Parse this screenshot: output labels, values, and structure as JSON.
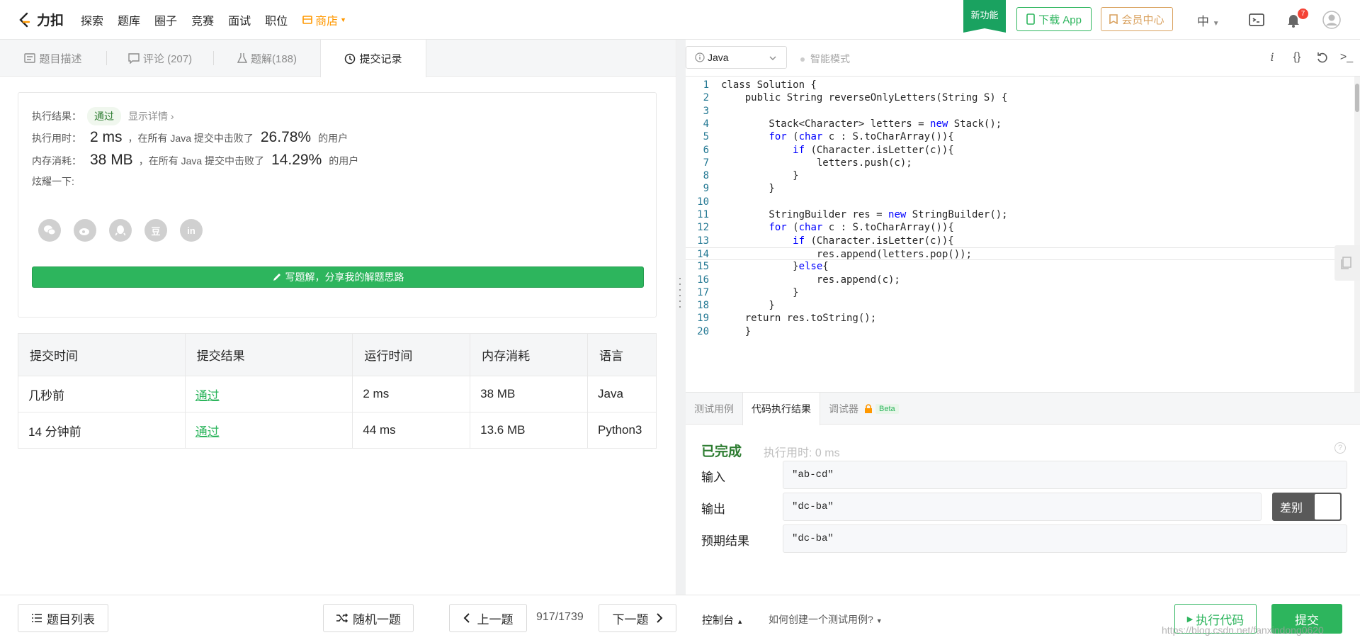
{
  "topbar": {
    "logo": "力扣",
    "nav": [
      "探索",
      "题库",
      "圈子",
      "竞赛",
      "面试",
      "职位"
    ],
    "shop": "商店",
    "new_feature": "新功能",
    "download_app": "下载 App",
    "vip": "会员中心",
    "lang": "中",
    "notification_count": "7"
  },
  "left_tabs": [
    {
      "label": "题目描述"
    },
    {
      "label": "评论 (207)"
    },
    {
      "label": "题解(188)"
    },
    {
      "label": "提交记录"
    }
  ],
  "result": {
    "result_label": "执行结果：",
    "result_value": "通过",
    "detail_link": "显示详情 ›",
    "time_label": "执行用时：",
    "time_value": "2 ms",
    "time_mid": "，在所有 Java 提交中击败了",
    "time_pct": "26.78%",
    "time_suffix": "的用户",
    "mem_label": "内存消耗：",
    "mem_value": "38 MB",
    "mem_mid": "，在所有 Java 提交中击败了",
    "mem_pct": "14.29%",
    "mem_suffix": "的用户",
    "share_label": "炫耀一下:",
    "share_icons": [
      "wechat-icon",
      "weibo-icon",
      "qq-icon",
      "douban-icon",
      "linkedin-icon"
    ],
    "douban_glyph": "豆",
    "linkedin_glyph": "in",
    "write_button": "写题解，分享我的解题思路"
  },
  "submissions": {
    "headers": [
      "提交时间",
      "提交结果",
      "运行时间",
      "内存消耗",
      "语言"
    ],
    "rows": [
      [
        "几秒前",
        "通过",
        "2 ms",
        "38 MB",
        "Java"
      ],
      [
        "14 分钟前",
        "通过",
        "44 ms",
        "13.6 MB",
        "Python3"
      ]
    ]
  },
  "editor": {
    "language": "Java",
    "smart_mode": "智能模式",
    "lines": [
      "class Solution {",
      "    public String reverseOnlyLetters(String S) {",
      "",
      "        Stack<Character> letters = new Stack();",
      "        for (char c : S.toCharArray()){",
      "            if (Character.isLetter(c)){",
      "                letters.push(c);",
      "            }",
      "        }",
      "",
      "        StringBuilder res = new StringBuilder();",
      "        for (char c : S.toCharArray()){",
      "            if (Character.isLetter(c)){",
      "                res.append(letters.pop());",
      "            }else{",
      "                res.append(c);",
      "            }",
      "        }",
      "    return res.toString();",
      "    }"
    ]
  },
  "bottom_tabs": {
    "testcase": "测试用例",
    "result": "代码执行结果",
    "debugger": "调试器",
    "beta": "Beta"
  },
  "exec": {
    "status": "已完成",
    "time": "执行用时: 0 ms",
    "input_label": "输入",
    "input_value": "\"ab-cd\"",
    "output_label": "输出",
    "output_value": "\"dc-ba\"",
    "expected_label": "预期结果",
    "expected_value": "\"dc-ba\"",
    "diff_label": "差别"
  },
  "bottombar": {
    "problem_list": "题目列表",
    "random": "随机一题",
    "prev": "上一题",
    "pager": "917/1739",
    "next": "下一题",
    "console": "控制台",
    "howto": "如何创建一个测试用例?",
    "run": "执行代码",
    "submit": "提交",
    "watermark": "https://blog.csdn.net/fanxindong0620"
  }
}
